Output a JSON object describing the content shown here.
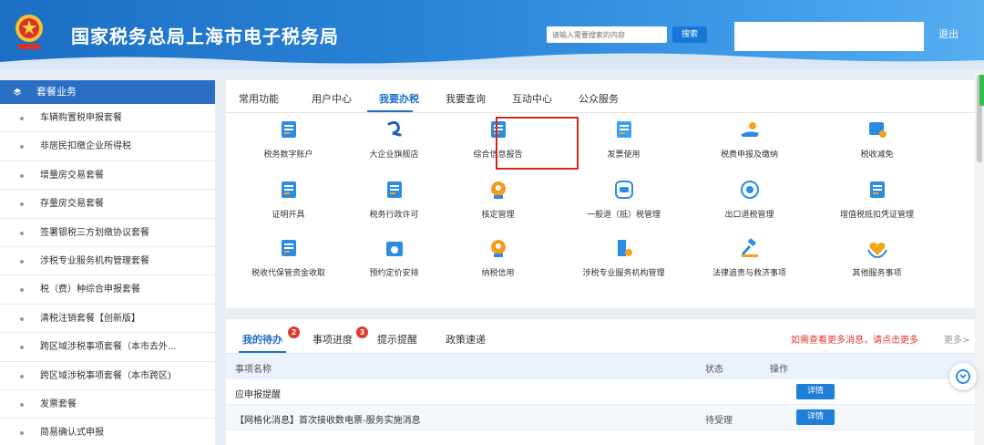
{
  "header": {
    "site_title": "国家税务总局上海市电子税务局",
    "search_placeholder": "请输入需要搜索的内容",
    "search_button": "搜索",
    "logout": "退出"
  },
  "sidebar": {
    "title": "套餐业务",
    "items": [
      "车辆购置税申报套餐",
      "非居民扣缴企业所得税",
      "增量房交易套餐",
      "存量房交易套餐",
      "签署银税三方划缴协议套餐",
      "涉税专业服务机构管理套餐",
      "税（费）种综合申报套餐",
      "清税注销套餐【创新版】",
      "跨区域涉税事项套餐（本市去外...",
      "跨区域涉税事项套餐（本市跨区)",
      "发票套餐",
      "简易确认式申报"
    ]
  },
  "tabs": [
    "常用功能",
    "用户中心",
    "我要办税",
    "我要查询",
    "互动中心",
    "公众服务"
  ],
  "services": [
    {
      "label": "税务数字账户",
      "icon": "id-card-icon",
      "color": "#2c8be3"
    },
    {
      "label": "大企业旗舰店",
      "icon": "enterprise-logo-icon",
      "color": "#1f5fb8"
    },
    {
      "label": "综合信息报告",
      "icon": "report-document-icon",
      "color": "#2c8be3"
    },
    {
      "label": "发票使用",
      "icon": "invoice-icon",
      "color": "#39a0ef"
    },
    {
      "label": "税费申报及缴纳",
      "icon": "hand-coin-icon",
      "color": "#2c8be3"
    },
    {
      "label": "税收减免",
      "icon": "tax-reduction-icon",
      "color": "#2c8be3"
    },
    {
      "label": "证明开具",
      "icon": "certificate-icon",
      "color": "#2c8be3"
    },
    {
      "label": "税务行政许可",
      "icon": "license-icon",
      "color": "#2c8be3"
    },
    {
      "label": "核定管理",
      "icon": "user-verify-icon",
      "color": "#f39c1f"
    },
    {
      "label": "一般退（抵）税管理",
      "icon": "refund-icon",
      "color": "#2c8be3"
    },
    {
      "label": "出口退税管理",
      "icon": "export-tax-icon",
      "color": "#2c8be3"
    },
    {
      "label": "增值税抵扣凭证管理",
      "icon": "voucher-icon",
      "color": "#2c8be3"
    },
    {
      "label": "税收代保管资金收取",
      "icon": "fund-icon",
      "color": "#2c8be3"
    },
    {
      "label": "预约定价安排",
      "icon": "calendar-price-icon",
      "color": "#2c8be3"
    },
    {
      "label": "纳税信用",
      "icon": "credit-medal-icon",
      "color": "#f39c1f"
    },
    {
      "label": "涉税专业服务机构管理",
      "icon": "building-gear-icon",
      "color": "#2c8be3"
    },
    {
      "label": "法律追责与救济事项",
      "icon": "gavel-icon",
      "color": "#2c8be3"
    },
    {
      "label": "其他服务事项",
      "icon": "heart-hands-icon",
      "color": "#2c8be3"
    }
  ],
  "todo": {
    "tabs": [
      {
        "label": "我的待办",
        "badge": "2"
      },
      {
        "label": "事项进度",
        "badge": "3"
      },
      {
        "label": "提示提醒",
        "badge": ""
      },
      {
        "label": "政策速递",
        "badge": ""
      }
    ],
    "notice": "如需查看更多消息，请点击更多",
    "more": "更多>",
    "columns": {
      "name": "事项名称",
      "status": "状态",
      "op": "操作"
    },
    "rows": [
      {
        "name": "应申报提醒",
        "status": "",
        "action": "详情"
      },
      {
        "name": "【网格化消息】首次接收数电票-服务实施消息",
        "status": "待受理",
        "action": "详情"
      }
    ]
  }
}
